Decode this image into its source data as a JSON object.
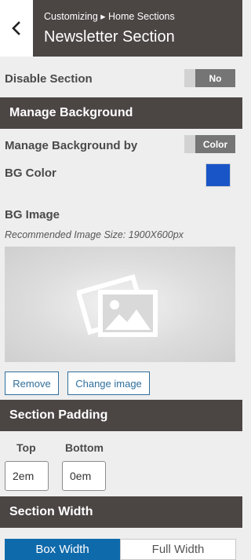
{
  "header": {
    "breadcrumb": "Customizing ▸ Home Sections",
    "title": "Newsletter Section",
    "back_icon": "chevron-left-icon"
  },
  "disable_section": {
    "label": "Disable Section",
    "toggle_value": "No"
  },
  "manage_background": {
    "heading": "Manage Background",
    "by_label": "Manage Background by",
    "by_value": "Color",
    "bg_color_label": "BG Color",
    "bg_color_value": "#1a55c8",
    "bg_image_label": "BG Image",
    "recommended_size": "Recommended Image Size: 1900X600px",
    "placeholder_icon": "image-placeholder-icon",
    "remove_label": "Remove",
    "change_label": "Change image"
  },
  "section_padding": {
    "heading": "Section Padding",
    "top_label": "Top",
    "top_value": "2em",
    "bottom_label": "Bottom",
    "bottom_value": "0em"
  },
  "section_width": {
    "heading": "Section Width",
    "options": [
      "Box Width",
      "Full Width"
    ],
    "selected": "Box Width"
  }
}
